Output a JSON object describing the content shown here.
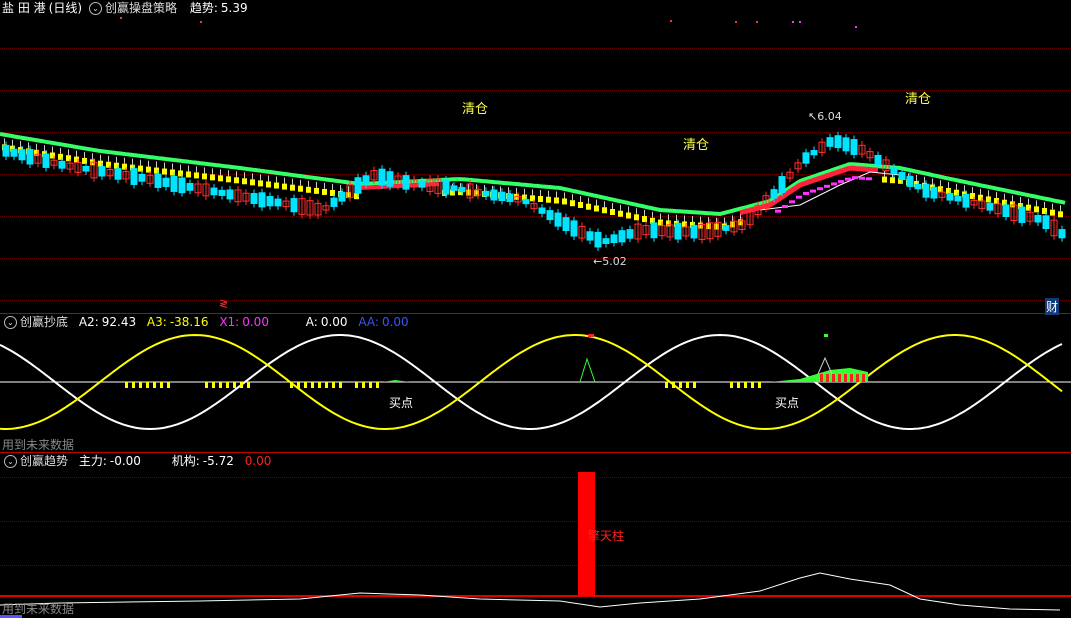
{
  "main": {
    "stock_name": "盐 田 港",
    "period": "(日线)",
    "indicator_name": "创赢操盘策略",
    "trend_label": "趋势:",
    "trend_value": "5.39",
    "annotations": [
      "清仓",
      "清仓",
      "清仓"
    ],
    "high_price": "6.04",
    "low_price": "5.02",
    "bottom_left_marker": "≷",
    "bottom_right_marker": "财",
    "colors": {
      "up": "#ff2020",
      "down": "#00e5ff",
      "band_green": "#33ff66",
      "band_yellow": "#ffff00",
      "magenta": "#ff33ff"
    }
  },
  "sub1": {
    "indicator_name": "创赢抄底",
    "a2_label": "A2:",
    "a2_value": "92.43",
    "a3_label": "A3:",
    "a3_value": "-38.16",
    "x1_label": "X1:",
    "x1_value": "0.00",
    "a_label": "A:",
    "a_value": "0.00",
    "aa_label": "AA:",
    "aa_value": "0.00",
    "buy_labels": [
      "买点",
      "买点"
    ],
    "footer": "用到未来数据",
    "colors": {
      "a2": "#ffffff",
      "a3": "#ffff00",
      "x1": "#ff33ff",
      "a": "#ffffff",
      "aa": "#3355ff"
    }
  },
  "sub2": {
    "indicator_name": "创赢趋势",
    "main_label": "主力:",
    "main_value": "-0.00",
    "inst_label": "机构:",
    "inst_value": "-5.72",
    "extra_value": "0.00",
    "pillar_label": "擎天柱",
    "footer": "用到未来数据",
    "colors": {
      "pillar": "#ff0000"
    }
  }
}
